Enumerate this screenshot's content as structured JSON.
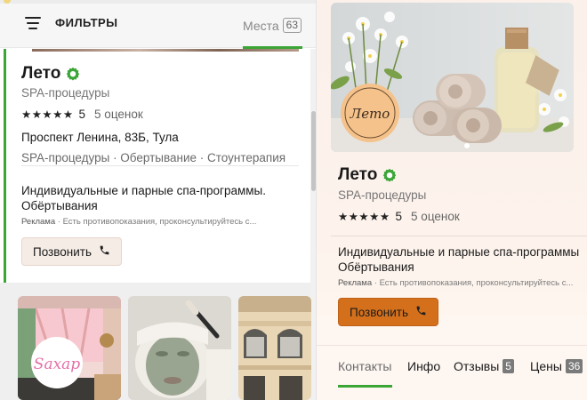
{
  "colors": {
    "accent_green": "#3ba536",
    "call_orange": "#d4701c",
    "call_light": "#f5ece6"
  },
  "filters": {
    "label": "ФИЛЬТРЫ",
    "icon": "filter-lines-icon"
  },
  "places_tab": {
    "label": "Места",
    "count": "63"
  },
  "place": {
    "title": "Лето",
    "category": "SPA-процедуры",
    "stars": "★★★★★",
    "rating": "5",
    "reviews": "5 оценок",
    "address": "Проспект Ленина, 83Б, Тула",
    "tags": "SPA-процедуры · Обертывание · Стоунтерапия",
    "promo_left": "Индивидуальные и парные спа-программы. Обёртывания",
    "promo_right_line1": "Индивидуальные и парные спа-программы",
    "promo_right_line2": "Обёртывания",
    "ad_label": "Реклама",
    "ad_sep": "·",
    "ad_text_left": "Есть противопоказания, проконсультируйтесь с...",
    "ad_text_right": "Есть противопоказания, проконсультируйтесь с...",
    "call_label": "Позвонить",
    "logo_text": "Лето"
  },
  "thumbnails": [
    {
      "name": "sahar-salon",
      "logo_text": "Sахар"
    },
    {
      "name": "face-mask"
    },
    {
      "name": "building-facade"
    }
  ],
  "tabs": [
    {
      "label": "Контакты",
      "count": ""
    },
    {
      "label": "Инфо",
      "count": ""
    },
    {
      "label": "Отзывы",
      "count": "5"
    },
    {
      "label": "Цены",
      "count": "36"
    }
  ]
}
